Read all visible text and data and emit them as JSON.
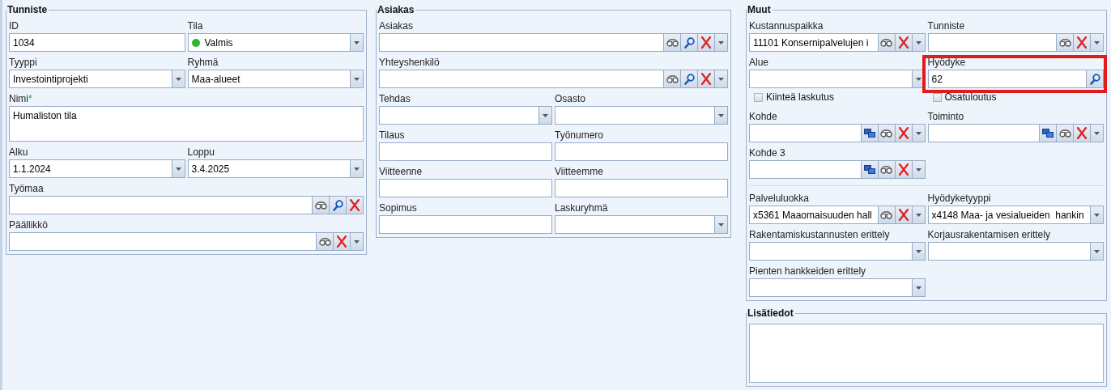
{
  "groups": [
    {
      "title": "Tunniste",
      "sections": [
        {
          "rows": [
            {
              "fields": [
                {
                  "kind": "input",
                  "label": "ID",
                  "value": "1034",
                  "highlighted": false
                },
                {
                  "kind": "input",
                  "label": "Tila",
                  "value": "Valmis",
                  "color": "#2fb52f",
                  "buttons": [
                    {
                      "kind": "dropdown"
                    }
                  ],
                  "highlighted": false
                }
              ]
            },
            {
              "fields": [
                {
                  "kind": "input",
                  "label": "Tyyppi",
                  "value": "Investointiprojekti",
                  "buttons": [
                    {
                      "kind": "dropdown"
                    }
                  ],
                  "highlighted": false
                },
                {
                  "kind": "input",
                  "label": "Ryhmä",
                  "value": "Maa-alueet",
                  "buttons": [
                    {
                      "kind": "dropdown"
                    }
                  ],
                  "highlighted": false
                }
              ]
            },
            {
              "fields": [
                {
                  "kind": "memo",
                  "label": "Nimi",
                  "required_mark": "*",
                  "value": "Humaliston tila",
                  "highlighted": false
                }
              ]
            },
            {
              "fields": [
                {
                  "kind": "input",
                  "label": "Alku",
                  "value": "1.1.2024",
                  "buttons": [
                    {
                      "kind": "dropdown"
                    }
                  ],
                  "highlighted": false
                },
                {
                  "kind": "input",
                  "label": "Loppu",
                  "value": "3.4.2025",
                  "buttons": [
                    {
                      "kind": "dropdown"
                    }
                  ],
                  "highlighted": false
                }
              ]
            },
            {
              "fields": [
                {
                  "kind": "input",
                  "label": "Työmaa",
                  "buttons": [
                    {
                      "kind": "browse"
                    },
                    {
                      "kind": "search"
                    },
                    {
                      "kind": "clear"
                    }
                  ],
                  "highlighted": false
                }
              ]
            },
            {
              "fields": [
                {
                  "kind": "input",
                  "label": "Päällikkö",
                  "buttons": [
                    {
                      "kind": "browse"
                    },
                    {
                      "kind": "clear"
                    },
                    {
                      "kind": "dropdown"
                    }
                  ],
                  "highlighted": false
                }
              ]
            }
          ]
        }
      ]
    },
    {
      "title": "Asiakas",
      "sections": [
        {
          "rows": [
            {
              "fields": [
                {
                  "kind": "input",
                  "label": "Asiakas",
                  "buttons": [
                    {
                      "kind": "browse"
                    },
                    {
                      "kind": "search"
                    },
                    {
                      "kind": "clear"
                    },
                    {
                      "kind": "dropdown"
                    }
                  ],
                  "highlighted": false
                }
              ]
            },
            {
              "fields": [
                {
                  "kind": "input",
                  "label": "Yhteyshenkilö",
                  "buttons": [
                    {
                      "kind": "browse"
                    },
                    {
                      "kind": "search"
                    },
                    {
                      "kind": "clear"
                    },
                    {
                      "kind": "dropdown"
                    }
                  ],
                  "highlighted": false
                }
              ]
            },
            {
              "fields": [
                {
                  "kind": "input",
                  "label": "Tehdas",
                  "buttons": [
                    {
                      "kind": "dropdown"
                    }
                  ],
                  "highlighted": false
                },
                {
                  "kind": "input",
                  "label": "Osasto",
                  "buttons": [
                    {
                      "kind": "dropdown"
                    }
                  ],
                  "highlighted": false
                }
              ]
            },
            {
              "fields": [
                {
                  "kind": "input",
                  "label": "Tilaus",
                  "highlighted": false
                },
                {
                  "kind": "input",
                  "label": "Työnumero",
                  "highlighted": false
                }
              ]
            },
            {
              "fields": [
                {
                  "kind": "input",
                  "label": "Viitteenne",
                  "highlighted": false
                },
                {
                  "kind": "input",
                  "label": "Viitteemme",
                  "highlighted": false
                }
              ]
            },
            {
              "fields": [
                {
                  "kind": "input",
                  "label": "Sopimus",
                  "highlighted": false
                },
                {
                  "kind": "input",
                  "label": "Laskuryhmä",
                  "buttons": [
                    {
                      "kind": "dropdown"
                    }
                  ],
                  "highlighted": false
                }
              ]
            }
          ]
        }
      ]
    },
    {
      "title": "Muut",
      "sections": [
        {
          "rows": [
            {
              "fields": [
                {
                  "kind": "input",
                  "label": "Kustannuspaikka",
                  "value": "11101 Konsernipalvelujen i",
                  "buttons": [
                    {
                      "kind": "browse"
                    },
                    {
                      "kind": "clear"
                    },
                    {
                      "kind": "dropdown"
                    }
                  ],
                  "highlighted": false
                },
                {
                  "kind": "input",
                  "label": "Tunniste",
                  "buttons": [
                    {
                      "kind": "browse"
                    },
                    {
                      "kind": "clear"
                    },
                    {
                      "kind": "dropdown"
                    }
                  ],
                  "highlighted": false
                }
              ]
            },
            {
              "fields": [
                {
                  "kind": "input",
                  "label": "Alue",
                  "buttons": [
                    {
                      "kind": "dropdown"
                    }
                  ],
                  "highlighted": false
                },
                {
                  "kind": "input",
                  "label": "Hyödyke",
                  "value": "62",
                  "buttons": [
                    {
                      "kind": "search"
                    }
                  ],
                  "highlighted": true
                }
              ]
            },
            {
              "fields": [
                {
                  "kind": "checkbox",
                  "label": "Kiinteä laskutus",
                  "checked": false,
                  "highlighted": false
                },
                {
                  "kind": "checkbox",
                  "label": "Osatuloutus",
                  "checked": false,
                  "highlighted": false
                }
              ]
            },
            {
              "fields": [
                {
                  "kind": "input",
                  "label": "Kohde",
                  "buttons": [
                    {
                      "kind": "link"
                    },
                    {
                      "kind": "browse"
                    },
                    {
                      "kind": "clear"
                    },
                    {
                      "kind": "dropdown"
                    }
                  ],
                  "highlighted": false
                },
                {
                  "kind": "input",
                  "label": "Toiminto",
                  "buttons": [
                    {
                      "kind": "link"
                    },
                    {
                      "kind": "browse"
                    },
                    {
                      "kind": "clear"
                    },
                    {
                      "kind": "dropdown"
                    }
                  ],
                  "highlighted": false
                }
              ]
            },
            {
              "fields": [
                {
                  "kind": "input",
                  "label": "Kohde 3",
                  "buttons": [
                    {
                      "kind": "link"
                    },
                    {
                      "kind": "browse"
                    },
                    {
                      "kind": "clear"
                    },
                    {
                      "kind": "dropdown"
                    }
                  ],
                  "highlighted": false
                }
              ]
            }
          ]
        },
        {
          "rows": [
            {
              "fields": [
                {
                  "kind": "input",
                  "label": "Palveluluokka",
                  "value": "x5361 Maaomaisuuden hall",
                  "buttons": [
                    {
                      "kind": "browse"
                    },
                    {
                      "kind": "clear"
                    },
                    {
                      "kind": "dropdown"
                    }
                  ],
                  "highlighted": false
                },
                {
                  "kind": "input",
                  "label": "Hyödyketyyppi",
                  "value": "x4148 Maa- ja vesialueiden  hankin",
                  "buttons": [
                    {
                      "kind": "dropdown"
                    }
                  ],
                  "highlighted": false
                }
              ]
            },
            {
              "fields": [
                {
                  "kind": "input",
                  "label": "Rakentamiskustannusten erittely",
                  "buttons": [
                    {
                      "kind": "dropdown"
                    }
                  ],
                  "highlighted": false
                },
                {
                  "kind": "input",
                  "label": "Korjausrakentamisen erittely",
                  "buttons": [
                    {
                      "kind": "dropdown"
                    }
                  ],
                  "highlighted": false
                }
              ]
            },
            {
              "fields": [
                {
                  "kind": "input",
                  "label": "Pienten hankkeiden erittely",
                  "buttons": [
                    {
                      "kind": "dropdown"
                    }
                  ],
                  "highlighted": false
                }
              ]
            }
          ]
        }
      ]
    },
    {
      "title": "Lisätiedot",
      "sections": [
        {
          "rows": [
            {
              "fields": [
                {
                  "kind": "memo",
                  "highlighted": false
                }
              ]
            }
          ]
        }
      ]
    }
  ]
}
